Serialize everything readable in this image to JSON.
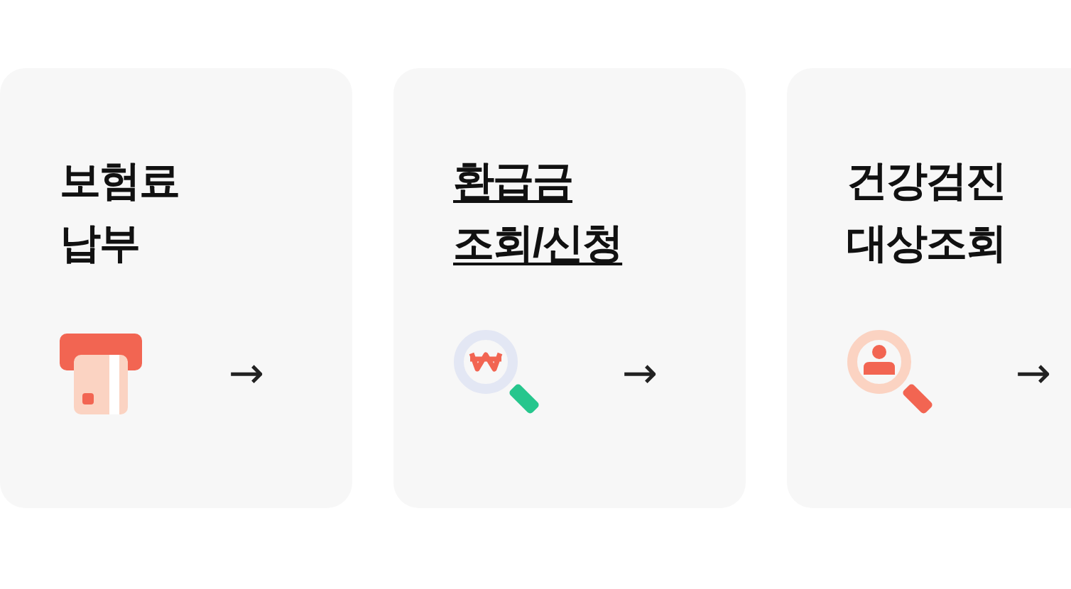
{
  "cards": [
    {
      "title": "보험료\n납부",
      "arrow": "→",
      "hovered": false
    },
    {
      "title": "환급금\n조회/신청",
      "arrow": "→",
      "hovered": true
    },
    {
      "title": "건강검진\n대상조회",
      "arrow": "→",
      "hovered": false
    }
  ]
}
